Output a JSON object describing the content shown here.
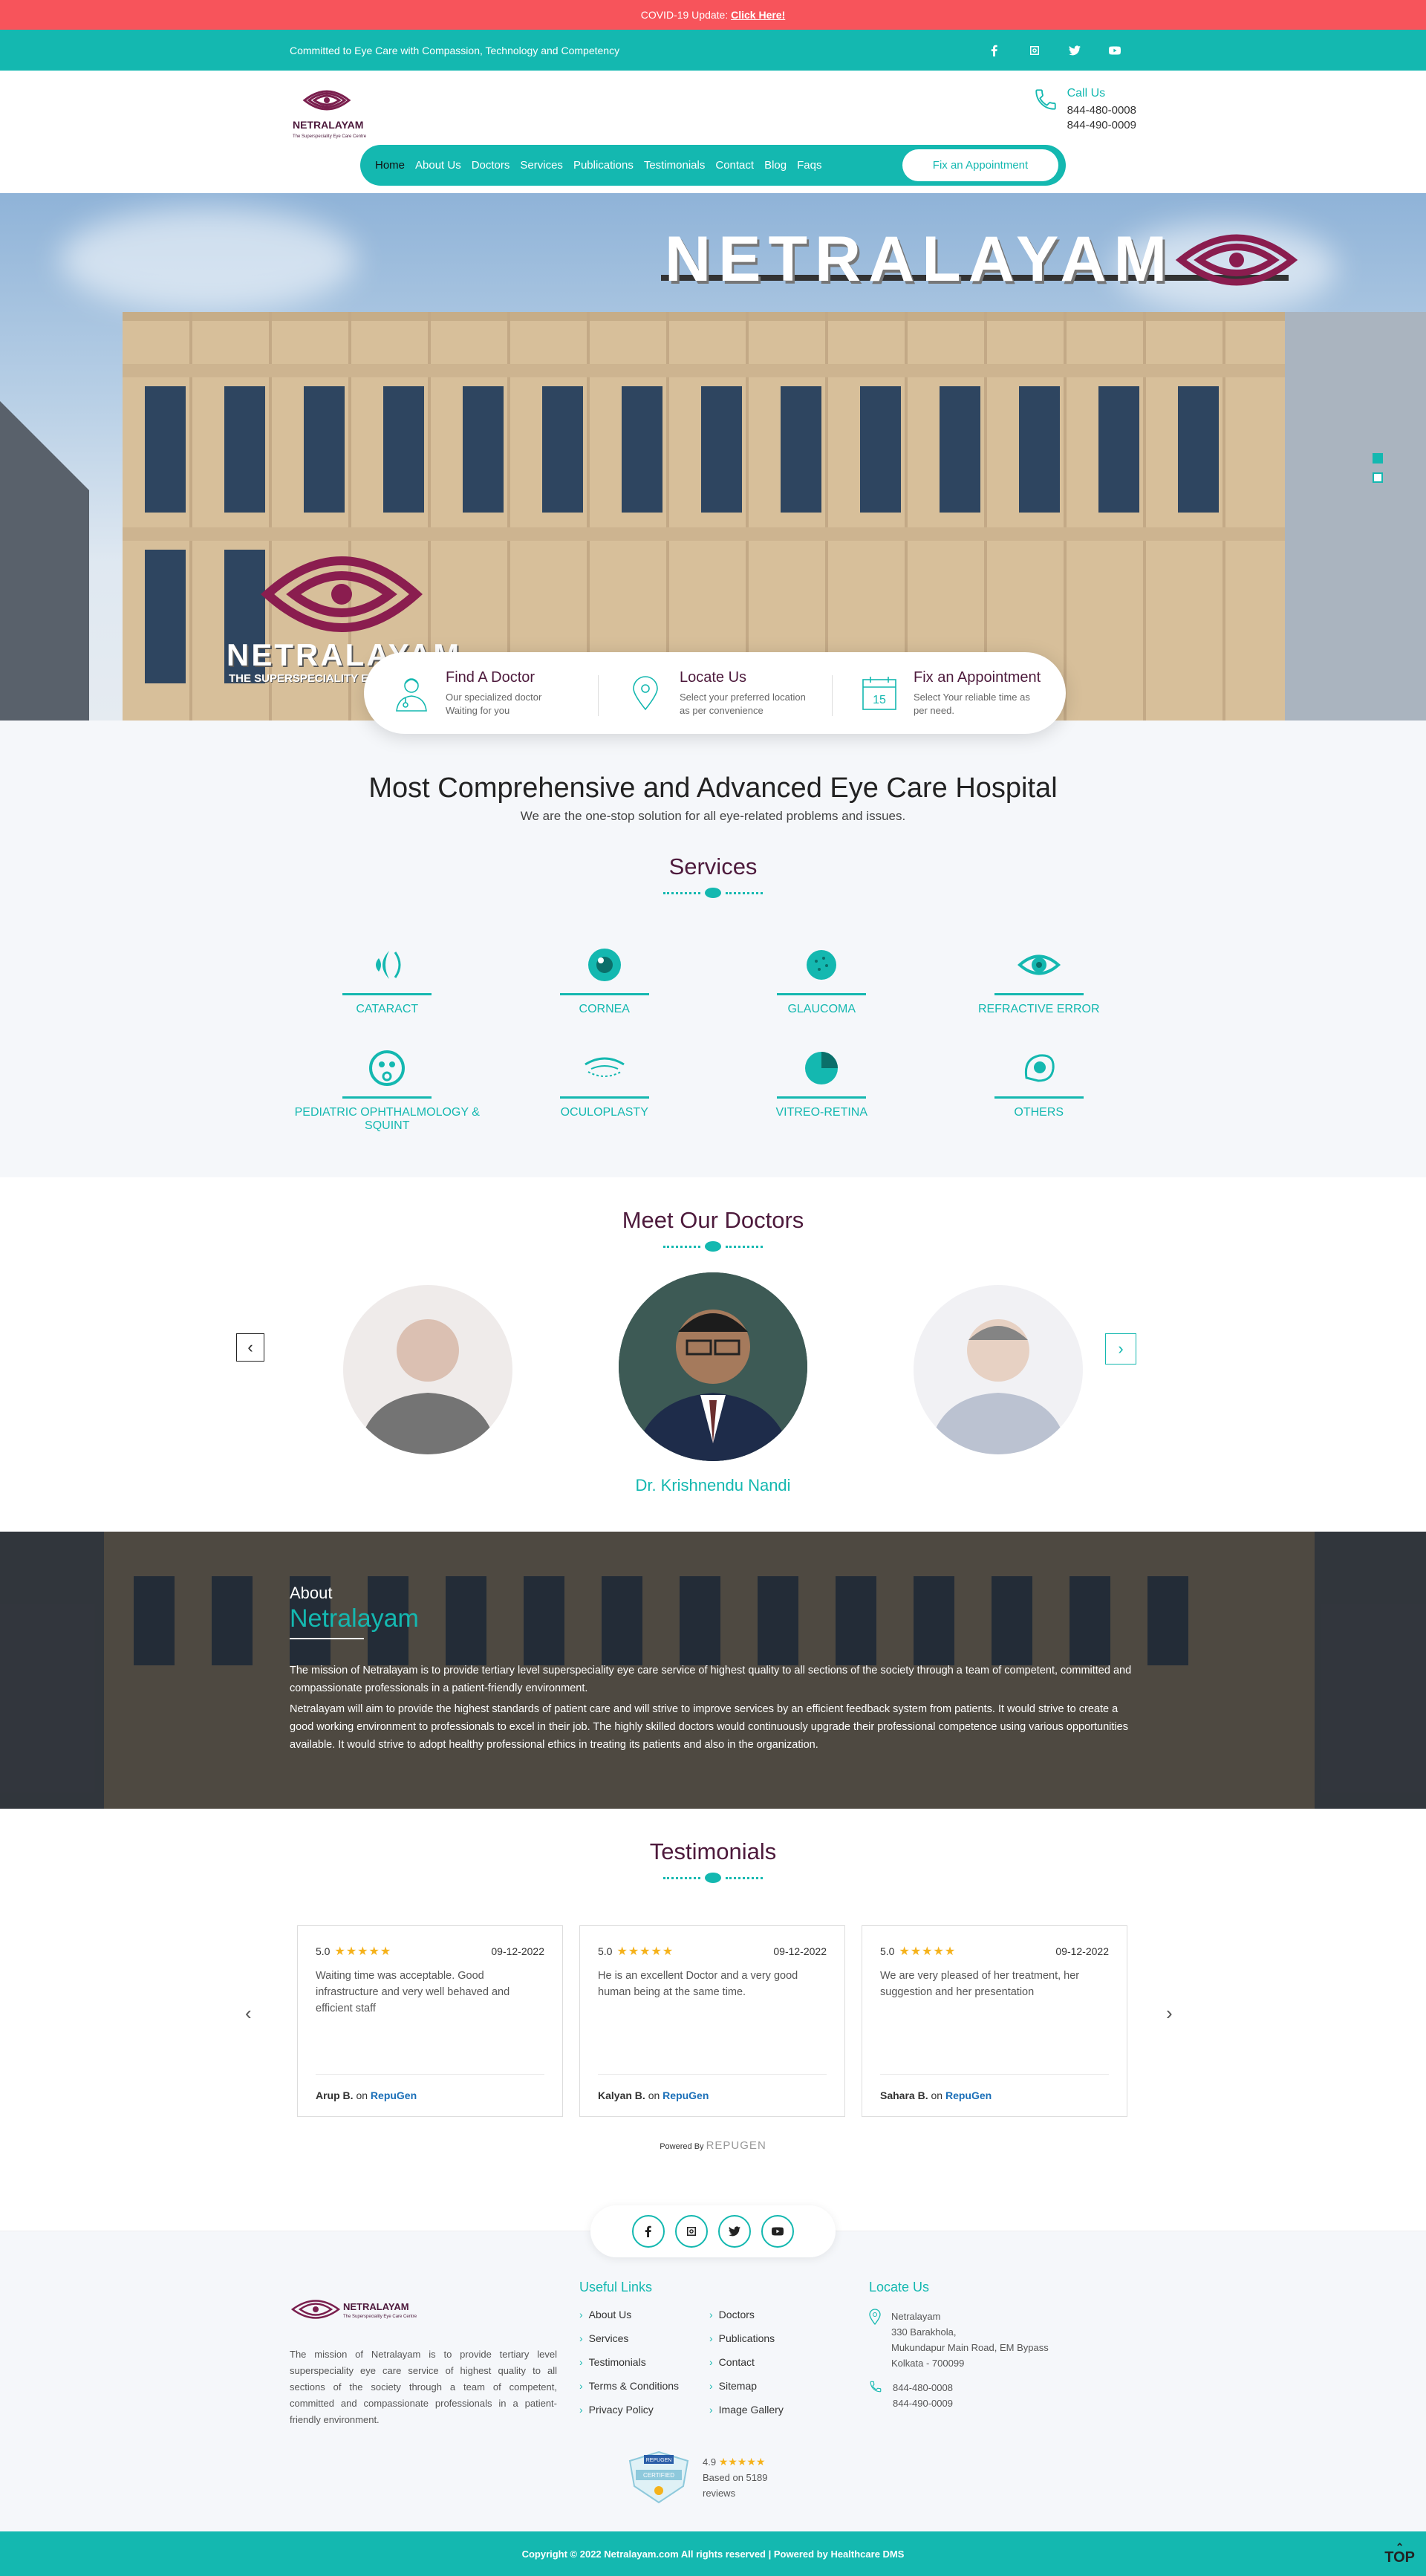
{
  "alert": {
    "text": "COVID-19 Update:",
    "link": "Click Here!"
  },
  "topbar": {
    "tagline": "Committed to Eye Care with Compassion, Technology and Competency",
    "social": [
      "facebook-icon",
      "instagram-icon",
      "twitter-icon",
      "youtube-icon"
    ]
  },
  "header": {
    "logo_text": "NETRALAYAM",
    "logo_tagline": "The Superspeciality Eye Care Centre",
    "call_label": "Call Us",
    "phones": [
      "844-480-0008",
      "844-490-0009"
    ],
    "nav": [
      "Home",
      "About Us",
      "Doctors",
      "Services",
      "Publications",
      "Testimonials",
      "Contact",
      "Blog",
      "Faqs"
    ],
    "active_nav": "Home",
    "cta": "Fix an Appointment"
  },
  "hero": {
    "sign": "NETRALAYAM",
    "logo_text": "NETRALAYAM",
    "logo_tagline": "THE SUPERSPECIALITY EYE CARE CENTRE",
    "slides": 2,
    "active_slide": 1
  },
  "features": [
    {
      "title": "Find A Doctor",
      "desc": [
        "Our specialized doctor",
        "Waiting for you"
      ],
      "icon": "doctor-icon"
    },
    {
      "title": "Locate Us",
      "desc": [
        "Select your preferred location",
        "as per convenience"
      ],
      "icon": "location-pin-icon"
    },
    {
      "title": "Fix an Appointment",
      "desc": [
        "Select Your reliable time as",
        "per need."
      ],
      "icon": "calendar-icon",
      "day": "15"
    }
  ],
  "intro": {
    "title": "Most Comprehensive and Advanced Eye Care Hospital",
    "subtitle": "We are the one-stop solution for all eye-related problems and issues."
  },
  "services": {
    "heading": "Services",
    "items": [
      {
        "label": "CATARACT"
      },
      {
        "label": "CORNEA"
      },
      {
        "label": "GLAUCOMA"
      },
      {
        "label": "REFRACTIVE ERROR"
      },
      {
        "label": "PEDIATRIC OPHTHALMOLOGY & SQUINT"
      },
      {
        "label": "OCULOPLASTY"
      },
      {
        "label": "VITREO-RETINA"
      },
      {
        "label": "OTHERS"
      }
    ]
  },
  "doctors": {
    "heading": "Meet Our Doctors",
    "active_name": "Dr. Krishnendu Nandi",
    "prev": "‹",
    "next": "›"
  },
  "about": {
    "label": "About",
    "title": "Netralayam",
    "paragraphs": [
      "The mission of Netralayam is to provide tertiary level superspeciality eye care service of highest quality to all sections of the society through a team of competent, committed and compassionate professionals in a patient-friendly environment.",
      "Netralayam will aim to provide the highest standards of patient care and will strive to improve services by an efficient feedback system from patients. It would strive to create a good working environment to professionals to excel in their job. The highly skilled doctors would continuously upgrade their professional competence using various opportunities available. It would strive to adopt healthy professional ethics in treating its patients and also in the organization."
    ]
  },
  "testimonials": {
    "heading": "Testimonials",
    "items": [
      {
        "rating": "5.0",
        "stars": "★★★★★",
        "date": "09-12-2022",
        "text": "Waiting time was acceptable. Good infrastructure and very well behaved and efficient staff",
        "author": "Arup B.",
        "on": "on",
        "source": "RepuGen"
      },
      {
        "rating": "5.0",
        "stars": "★★★★★",
        "date": "09-12-2022",
        "text": "He is an excellent Doctor and a very good human being at the same time.",
        "author": "Kalyan B.",
        "on": "on",
        "source": "RepuGen"
      },
      {
        "rating": "5.0",
        "stars": "★★★★★",
        "date": "09-12-2022",
        "text": "We are very pleased of her treatment, her suggestion and her presentation",
        "author": "Sahara B.",
        "on": "on",
        "source": "RepuGen"
      }
    ],
    "powered_by": "Powered By",
    "brand": "REPUGEN"
  },
  "footer": {
    "logo_text": "NETRALAYAM",
    "logo_tagline": "The Superspeciality Eye Care Centre",
    "desc": "The mission of Netralayam is to provide tertiary level superspeciality eye care service of highest quality to all sections of the society through a team of competent, committed and compassionate professionals in a patient-friendly environment.",
    "links_heading": "Useful Links",
    "links": [
      "About Us",
      "Doctors",
      "Services",
      "Publications",
      "Testimonials",
      "Contact",
      "Terms & Conditions",
      "Sitemap",
      "Privacy Policy",
      "Image Gallery"
    ],
    "locate_heading": "Locate Us",
    "address": [
      "Netralayam",
      "330 Barakhola,",
      "Mukundapur Main Road, EM Bypass",
      "Kolkata - 700099"
    ],
    "phones": [
      "844-480-0008",
      "844-490-0009"
    ],
    "badge": {
      "rating": "4.9",
      "stars": "★★★★★",
      "text1": "Based on 5189",
      "text2": "reviews",
      "seal_top": "REPUGEN",
      "seal_mid": "CERTIFIED"
    },
    "copyright": "Copyright © 2022 Netralayam.com All rights reserved | Powered by Healthcare DMS",
    "top": "TOP"
  },
  "colors": {
    "teal": "#14b8b0",
    "plum": "#4d1a3c",
    "alert_red": "#f7545b"
  }
}
